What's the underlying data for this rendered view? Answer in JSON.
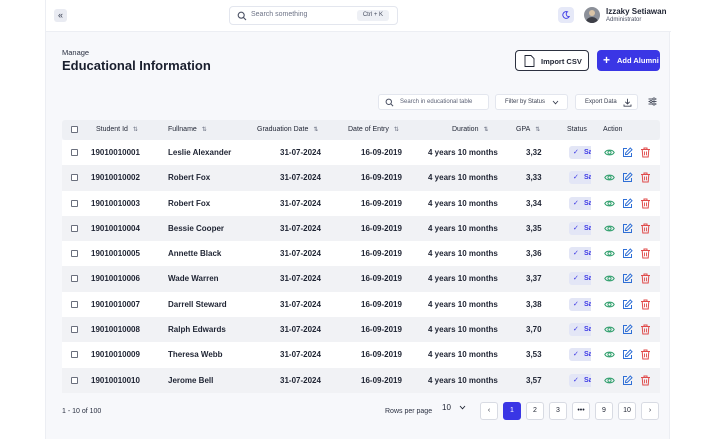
{
  "topbar": {
    "collapse_icon": "double-chevron-left-icon",
    "search_placeholder": "Search something",
    "search_shortcut": "Ctrl + K",
    "user_name": "Izzaky Setiawan",
    "user_role": "Administrator"
  },
  "header": {
    "breadcrumb": "Manage",
    "title": "Educational Information",
    "import_label": "Import CSV",
    "add_label": "Add Alumni"
  },
  "toolbar": {
    "search_placeholder": "Search in educational table",
    "filter_label": "Filter by Status",
    "export_label": "Export Data"
  },
  "table": {
    "columns": {
      "student_id": "Student Id",
      "fullname": "Fullname",
      "graduation_date": "Graduation Date",
      "date_of_entry": "Date of Entry",
      "duration": "Duration",
      "gpa": "GPA",
      "status": "Status",
      "action": "Action"
    },
    "rows": [
      {
        "student_id": "19010010001",
        "fullname": "Leslie Alexander",
        "graduation_date": "31-07-2024",
        "date_of_entry": "16-09-2019",
        "duration": "4 years 10 months",
        "gpa": "3,32",
        "status": "Sa"
      },
      {
        "student_id": "19010010002",
        "fullname": "Robert Fox",
        "graduation_date": "31-07-2024",
        "date_of_entry": "16-09-2019",
        "duration": "4 years 10 months",
        "gpa": "3,33",
        "status": "Sa"
      },
      {
        "student_id": "19010010003",
        "fullname": "Robert Fox",
        "graduation_date": "31-07-2024",
        "date_of_entry": "16-09-2019",
        "duration": "4 years 10 months",
        "gpa": "3,34",
        "status": "Sa"
      },
      {
        "student_id": "19010010004",
        "fullname": "Bessie Cooper",
        "graduation_date": "31-07-2024",
        "date_of_entry": "16-09-2019",
        "duration": "4 years 10 months",
        "gpa": "3,35",
        "status": "Sa"
      },
      {
        "student_id": "19010010005",
        "fullname": "Annette Black",
        "graduation_date": "31-07-2024",
        "date_of_entry": "16-09-2019",
        "duration": "4 years 10 months",
        "gpa": "3,36",
        "status": "Sa"
      },
      {
        "student_id": "19010010006",
        "fullname": "Wade Warren",
        "graduation_date": "31-07-2024",
        "date_of_entry": "16-09-2019",
        "duration": "4 years 10 months",
        "gpa": "3,37",
        "status": "Sa"
      },
      {
        "student_id": "19010010007",
        "fullname": "Darrell Steward",
        "graduation_date": "31-07-2024",
        "date_of_entry": "16-09-2019",
        "duration": "4 years 10 months",
        "gpa": "3,38",
        "status": "Sa"
      },
      {
        "student_id": "19010010008",
        "fullname": "Ralph Edwards",
        "graduation_date": "31-07-2024",
        "date_of_entry": "16-09-2019",
        "duration": "4 years 10 months",
        "gpa": "3,70",
        "status": "Sa"
      },
      {
        "student_id": "19010010009",
        "fullname": "Theresa Webb",
        "graduation_date": "31-07-2024",
        "date_of_entry": "16-09-2019",
        "duration": "4 years 10 months",
        "gpa": "3,53",
        "status": "Sa"
      },
      {
        "student_id": "19010010010",
        "fullname": "Jerome Bell",
        "graduation_date": "31-07-2024",
        "date_of_entry": "16-09-2019",
        "duration": "4 years 10 months",
        "gpa": "3,57",
        "status": "Sa"
      }
    ]
  },
  "pagination": {
    "count_text": "1 - 10 of 100",
    "rows_per_page_label": "Rows per page",
    "rows_per_page_value": "10",
    "pages": [
      "1",
      "2",
      "3",
      "•••",
      "9",
      "10"
    ],
    "active_page": "1"
  },
  "colors": {
    "accent": "#3a36e5",
    "view_icon": "#2e9e6b",
    "edit_icon": "#2f6fd6",
    "delete_icon": "#e04b4b"
  },
  "icons": {
    "view": "eye-icon",
    "edit": "edit-icon",
    "delete": "trash-icon",
    "status": "check-icon"
  }
}
